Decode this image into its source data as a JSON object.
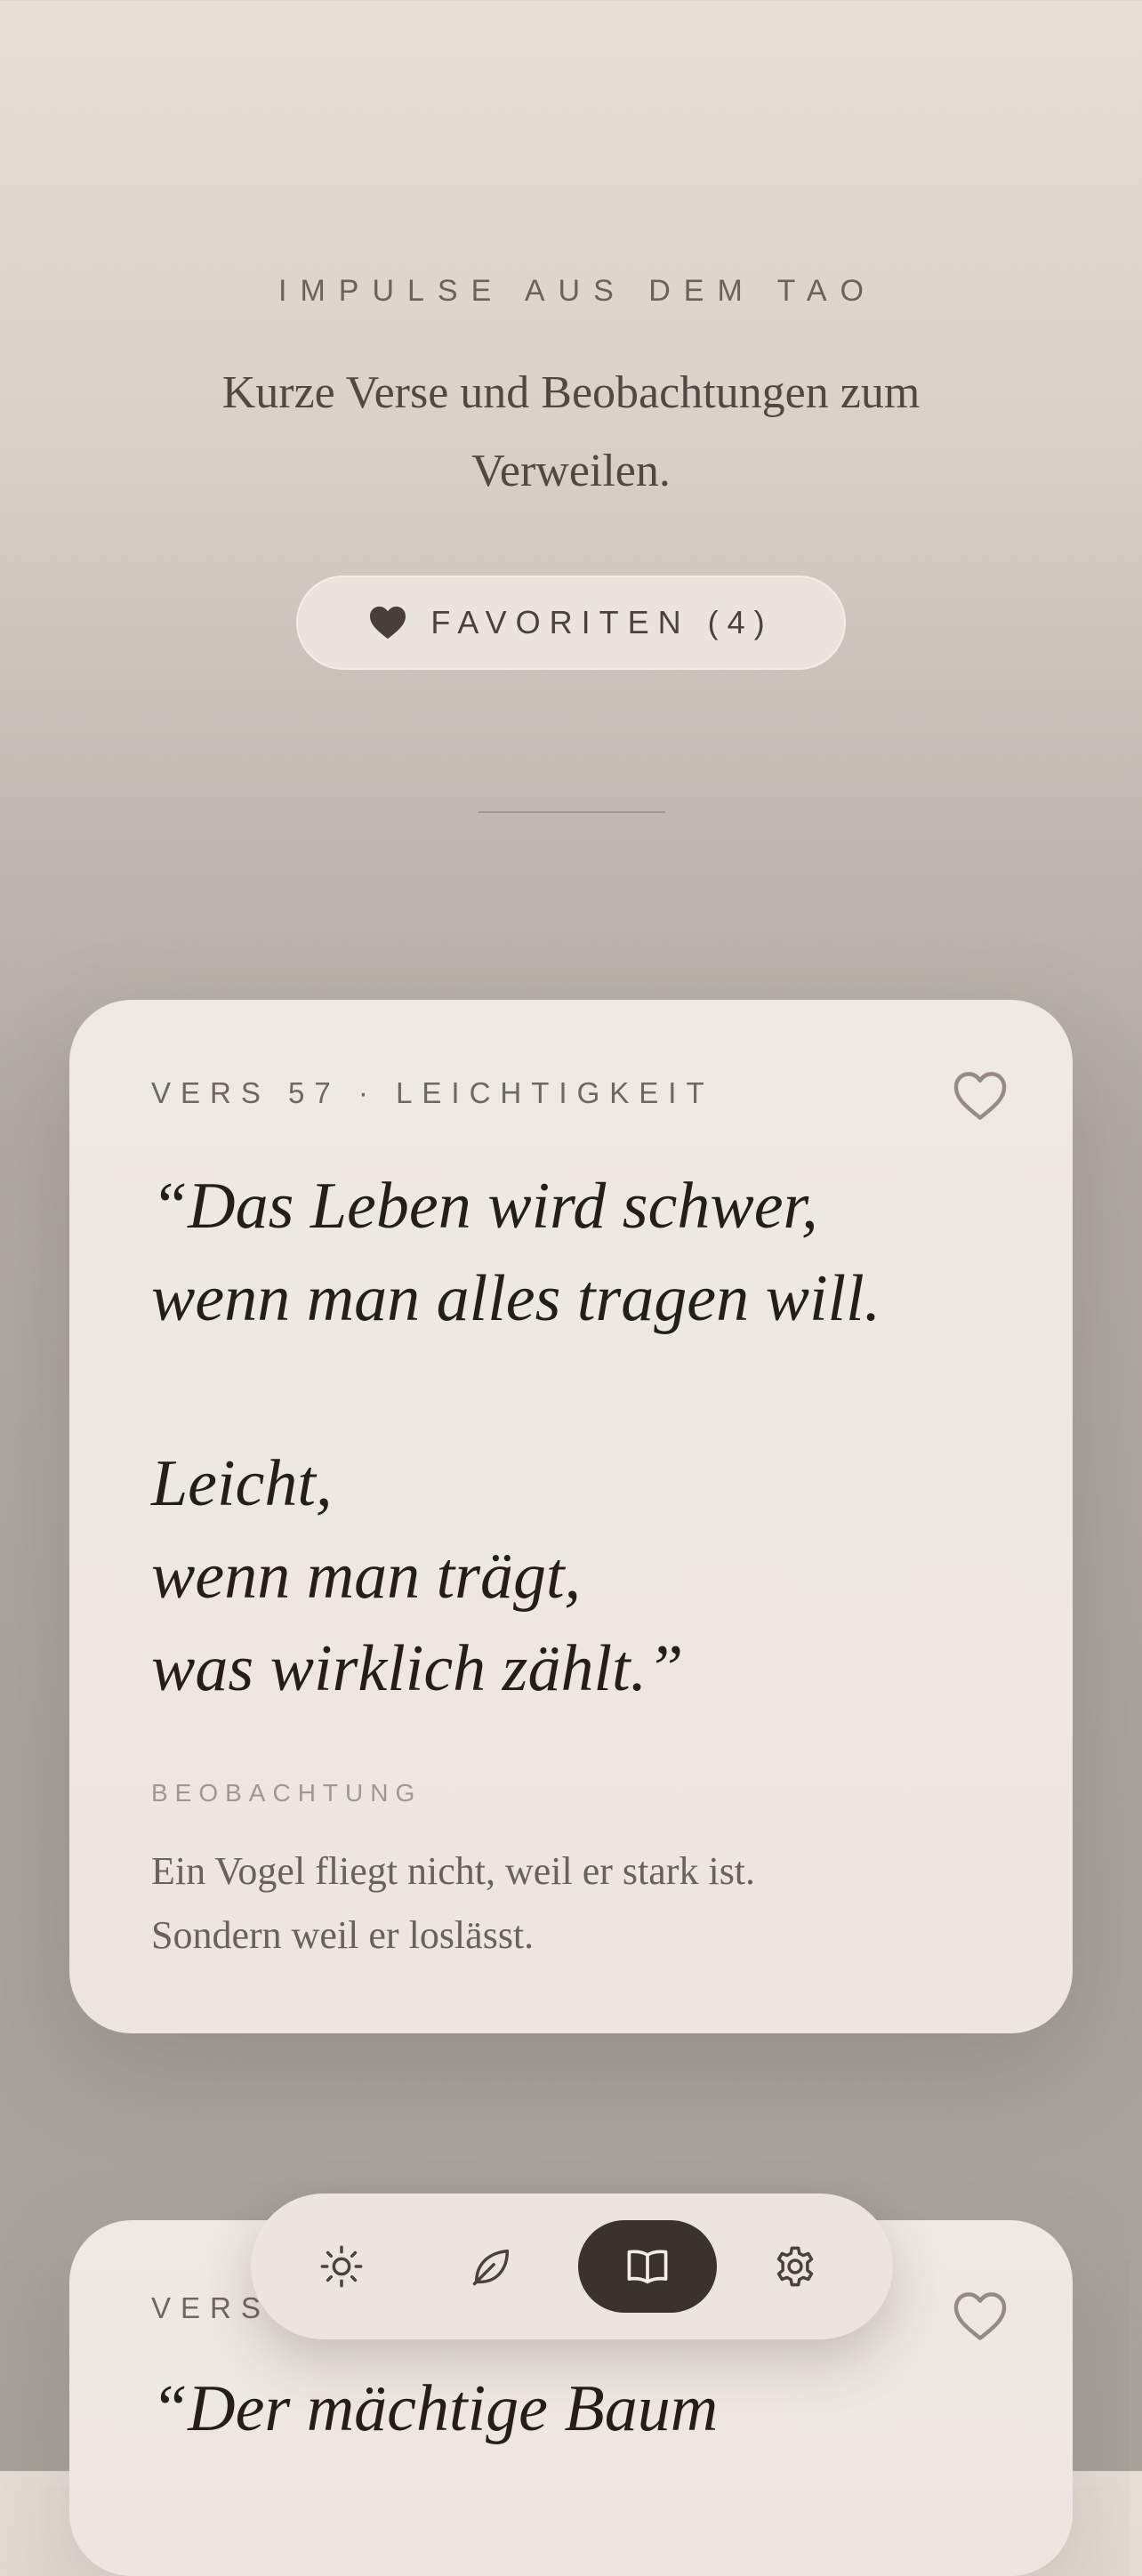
{
  "header": {
    "eyebrow": "IMPULSE AUS DEM TAO",
    "subtitle": "Kurze Verse und Beobachtungen zum Verweilen.",
    "favorites_label": "FAVORITEN (4)",
    "favorites_icon": "heart-filled-icon"
  },
  "cards": [
    {
      "meta": "VERS 57 · LEICHTIGKEIT",
      "quote": "“Das Leben wird schwer,\nwenn man alles tragen will.\n\nLeicht,\nwenn man trägt,\nwas wirklich zählt.”",
      "observation_label": "BEOBACHTUNG",
      "observation": "Ein Vogel fliegt nicht, weil er stark ist.\nSondern weil er loslässt.",
      "favorite_icon": "heart-outline-icon"
    },
    {
      "meta": "VERS",
      "quote": "“Der mächtige Baum",
      "favorite_icon": "heart-outline-icon"
    }
  ],
  "nav": {
    "items": [
      {
        "icon": "sun-icon",
        "active": false
      },
      {
        "icon": "leaf-icon",
        "active": false
      },
      {
        "icon": "book-icon",
        "active": true
      },
      {
        "icon": "gear-icon",
        "active": false
      }
    ]
  },
  "colors": {
    "accent_dark": "#3b322c",
    "card_bg": "#efe9e3",
    "text_primary": "#251d18"
  }
}
